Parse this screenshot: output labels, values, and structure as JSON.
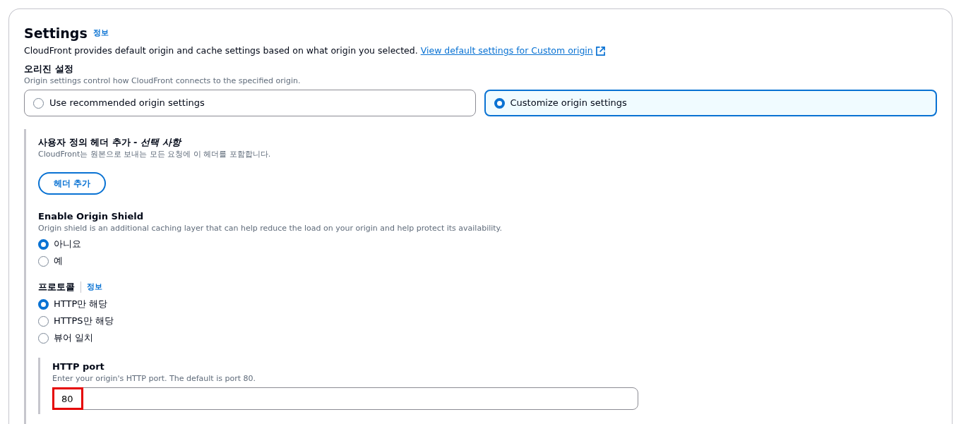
{
  "settings": {
    "title": "Settings",
    "info_link": "정보",
    "description": "CloudFront provides default origin and cache settings based on what origin you selected.",
    "defaults_link": "View default settings for Custom origin"
  },
  "origin_settings": {
    "label": "오리진 설정",
    "description": "Origin settings control how CloudFront connects to the specified origin.",
    "options": [
      {
        "label": "Use recommended origin settings",
        "selected": false
      },
      {
        "label": "Customize origin settings",
        "selected": true
      }
    ]
  },
  "custom_headers": {
    "label": "사용자 정의 헤더 추가 - *선택 사항*",
    "description": "CloudFront는 원본으로 보내는 모든 요청에 이 헤더를 포함합니다.",
    "button": "헤더 추가"
  },
  "origin_shield": {
    "label": "Enable Origin Shield",
    "description": "Origin shield is an additional caching layer that can help reduce the load on your origin and help protect its availability.",
    "options": [
      {
        "label": "아니요",
        "selected": true
      },
      {
        "label": "예",
        "selected": false
      }
    ]
  },
  "protocol": {
    "label": "프로토콜",
    "info_link": "정보",
    "options": [
      {
        "label": "HTTP만 해당",
        "selected": true
      },
      {
        "label": "HTTPS만 해당",
        "selected": false
      },
      {
        "label": "뷰어 일치",
        "selected": false
      }
    ]
  },
  "http_port": {
    "label": "HTTP port",
    "description": "Enter your origin's HTTP port. The default is port 80.",
    "value": "80",
    "highlighted": true
  }
}
